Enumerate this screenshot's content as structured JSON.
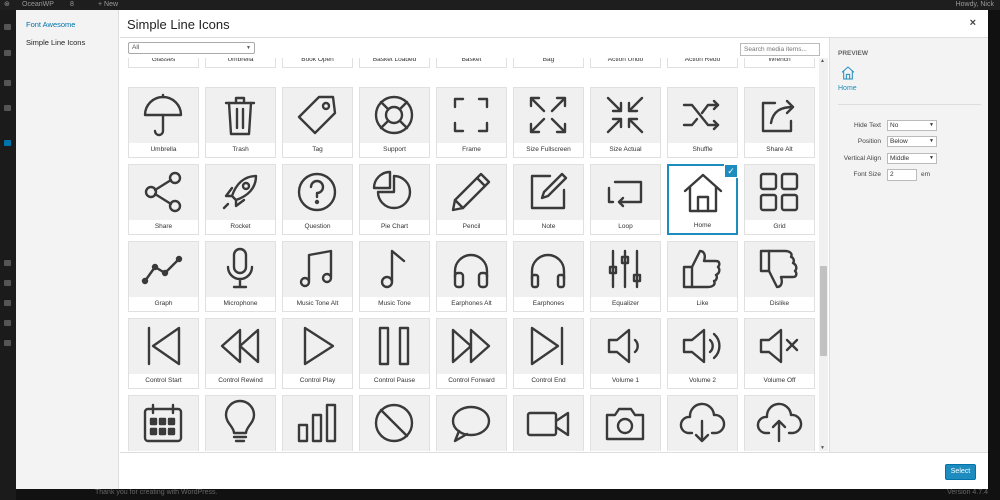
{
  "wp": {
    "site": "OceanWP",
    "notif": "8",
    "new": "+ New",
    "howdy": "Howdy, Nick",
    "footer": "Thank you for creating with WordPress.",
    "version": "Version 4.7.4"
  },
  "menu": {
    "items": [
      {
        "label": "Font Awesome",
        "active": true
      },
      {
        "label": "Simple Line Icons",
        "active": false
      }
    ]
  },
  "modal": {
    "title": "Simple Line Icons",
    "close": "×",
    "filter": "All",
    "search_placeholder": "Search media items...",
    "select_button": "Select"
  },
  "preview": {
    "title": "PREVIEW",
    "icon": "home-icon",
    "label": "Home",
    "fields": [
      {
        "label": "Hide Text",
        "value": "No",
        "type": "select"
      },
      {
        "label": "Position",
        "value": "Below",
        "type": "select"
      },
      {
        "label": "Vertical Align",
        "value": "Middle",
        "type": "select"
      },
      {
        "label": "Font Size",
        "value": "2",
        "unit": "em",
        "type": "number"
      }
    ]
  },
  "partial_row": [
    "Glasses",
    "Umbrella",
    "Book Open",
    "Basket Loaded",
    "Basket",
    "Bag",
    "Action Undo",
    "Action Redo",
    "Wrench"
  ],
  "icons": [
    {
      "label": "Umbrella",
      "icon": "umbrella"
    },
    {
      "label": "Trash",
      "icon": "trash"
    },
    {
      "label": "Tag",
      "icon": "tag"
    },
    {
      "label": "Support",
      "icon": "support"
    },
    {
      "label": "Frame",
      "icon": "frame"
    },
    {
      "label": "Size Fullscreen",
      "icon": "size-fullscreen"
    },
    {
      "label": "Size Actual",
      "icon": "size-actual"
    },
    {
      "label": "Shuffle",
      "icon": "shuffle"
    },
    {
      "label": "Share Alt",
      "icon": "share-alt"
    },
    {
      "label": "Share",
      "icon": "share"
    },
    {
      "label": "Rocket",
      "icon": "rocket"
    },
    {
      "label": "Question",
      "icon": "question"
    },
    {
      "label": "Pie Chart",
      "icon": "pie-chart"
    },
    {
      "label": "Pencil",
      "icon": "pencil"
    },
    {
      "label": "Note",
      "icon": "note"
    },
    {
      "label": "Loop",
      "icon": "loop"
    },
    {
      "label": "Home",
      "icon": "home",
      "selected": true
    },
    {
      "label": "Grid",
      "icon": "grid"
    },
    {
      "label": "Graph",
      "icon": "graph"
    },
    {
      "label": "Microphone",
      "icon": "microphone"
    },
    {
      "label": "Music Tone Alt",
      "icon": "music-tone-alt"
    },
    {
      "label": "Music Tone",
      "icon": "music-tone"
    },
    {
      "label": "Earphones Alt",
      "icon": "earphones-alt"
    },
    {
      "label": "Earphones",
      "icon": "earphones"
    },
    {
      "label": "Equalizer",
      "icon": "equalizer"
    },
    {
      "label": "Like",
      "icon": "like"
    },
    {
      "label": "Dislike",
      "icon": "dislike"
    },
    {
      "label": "Control Start",
      "icon": "control-start"
    },
    {
      "label": "Control Rewind",
      "icon": "control-rewind"
    },
    {
      "label": "Control Play",
      "icon": "control-play"
    },
    {
      "label": "Control Pause",
      "icon": "control-pause"
    },
    {
      "label": "Control Forward",
      "icon": "control-forward"
    },
    {
      "label": "Control End",
      "icon": "control-end"
    },
    {
      "label": "Volume 1",
      "icon": "volume-1"
    },
    {
      "label": "Volume 2",
      "icon": "volume-2"
    },
    {
      "label": "Volume Off",
      "icon": "volume-off"
    },
    {
      "label": "Calendar",
      "icon": "calendar"
    },
    {
      "label": "Bulb",
      "icon": "bulb"
    },
    {
      "label": "Chart",
      "icon": "chart"
    },
    {
      "label": "Ban",
      "icon": "ban"
    },
    {
      "label": "Bubble",
      "icon": "bubble"
    },
    {
      "label": "Camrecorder",
      "icon": "camrecorder"
    },
    {
      "label": "Camera",
      "icon": "camera"
    },
    {
      "label": "Cloud Download",
      "icon": "cloud-download"
    },
    {
      "label": "Cloud Upload",
      "icon": "cloud-upload"
    }
  ],
  "colors": {
    "accent": "#1e8cbe",
    "icon_stroke": "#3a3a3a",
    "tile_bg": "#f0f0f0"
  }
}
